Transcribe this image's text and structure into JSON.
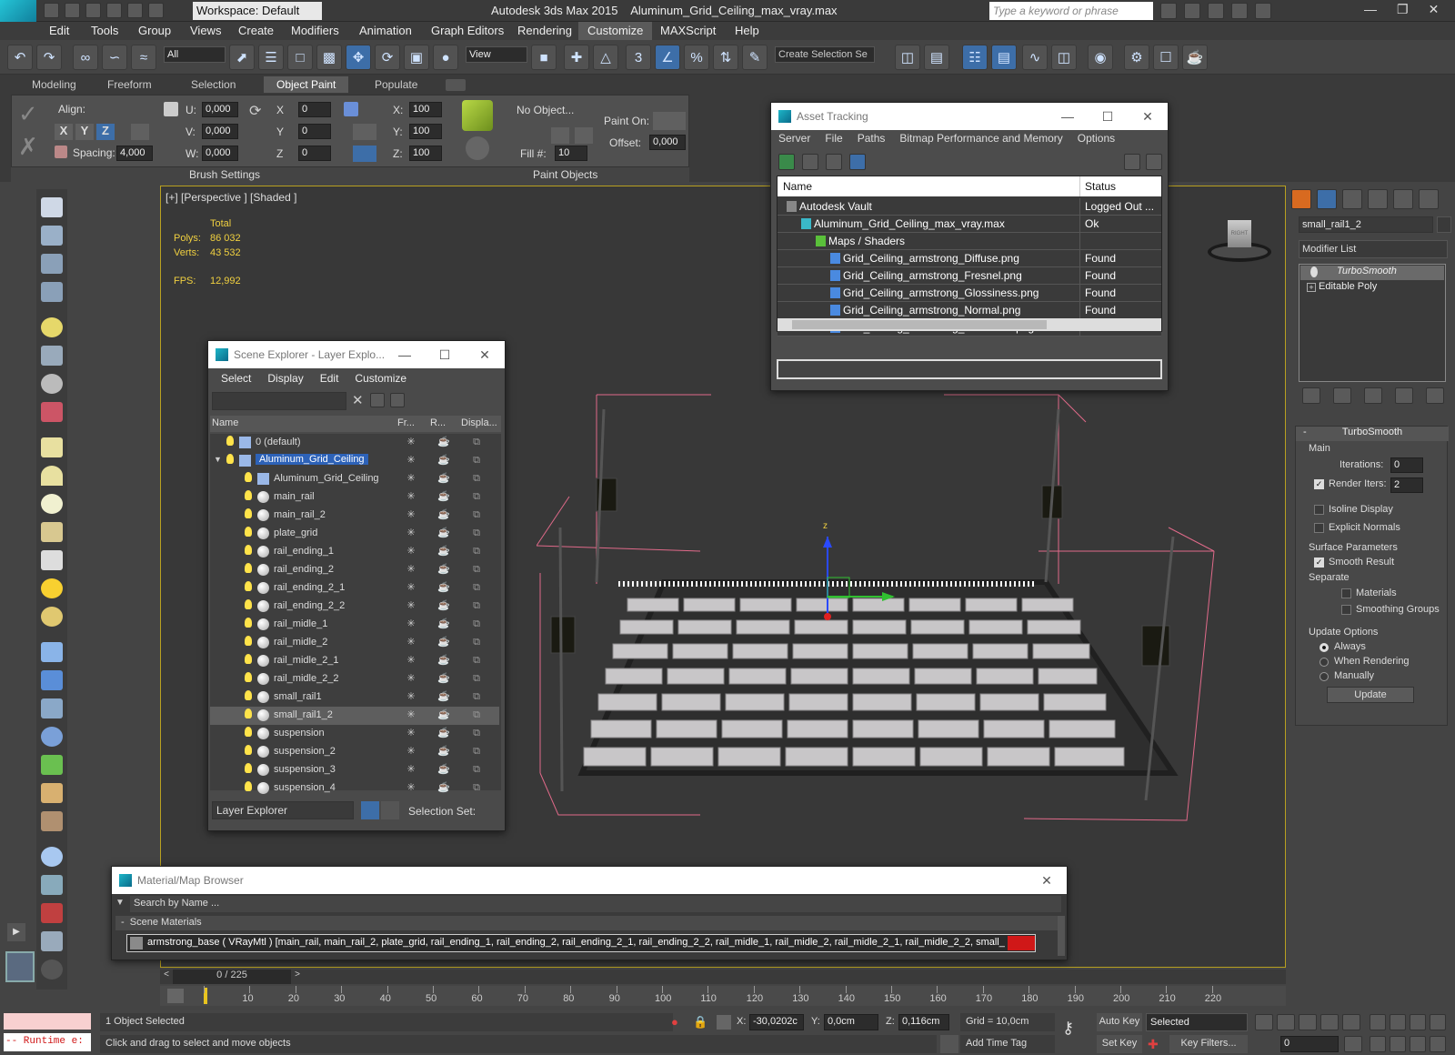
{
  "titlebar": {
    "app": "Autodesk 3ds Max  2015",
    "file": "Aluminum_Grid_Ceiling_max_vray.max",
    "workspace": "Workspace: Default",
    "search_placeholder": "Type a keyword or phrase",
    "logo_text": "MAX"
  },
  "menus": [
    "Edit",
    "Tools",
    "Group",
    "Views",
    "Create",
    "Modifiers",
    "Animation",
    "Graph Editors",
    "Rendering",
    "Customize",
    "MAXScript",
    "Help"
  ],
  "toolbar": {
    "filter": "All",
    "view": "View",
    "selection_set": "Create Selection Se",
    "snap_num": "3"
  },
  "ribbon": {
    "tabs": [
      "Modeling",
      "Freeform",
      "Selection",
      "Object Paint",
      "Populate"
    ],
    "active_tab": "Object Paint",
    "align_label": "Align:",
    "axes": [
      "X",
      "Y",
      "Z"
    ],
    "spacing_label": "Spacing:",
    "spacing_value": "4,000",
    "u_label": "U:",
    "v_label": "V:",
    "w_label": "W:",
    "uvw_value": "0,000",
    "x_label": "X",
    "y_label": "Y",
    "z_label": "Z",
    "xyz_value": "0",
    "sx_label": "X:",
    "sy_label": "Y:",
    "sz_label": "Z:",
    "scale_value": "100",
    "no_object": "No Object...",
    "fill_label": "Fill #:",
    "fill_value": "10",
    "paint_on_label": "Paint On:",
    "offset_label": "Offset:",
    "offset_value": "0,000",
    "brush_settings": "Brush Settings",
    "paint_objects": "Paint Objects"
  },
  "viewport": {
    "label": "[+] [Perspective ] [Shaded ]",
    "stats_header": "Total",
    "polys_label": "Polys:",
    "polys": "86 032",
    "verts_label": "Verts:",
    "verts": "43 532",
    "fps_label": "FPS:",
    "fps": "12,992",
    "gizmo_z": "z",
    "viewcube": "RIGHT"
  },
  "scene_explorer": {
    "title": "Scene Explorer - Layer Explo...",
    "menus": [
      "Select",
      "Display",
      "Edit",
      "Customize"
    ],
    "cols": [
      "Name",
      "Fr...",
      "R...",
      "Displa..."
    ],
    "layers": [
      {
        "name": "0 (default)",
        "level": 0,
        "kind": "layer"
      },
      {
        "name": "Aluminum_Grid_Ceiling",
        "level": 0,
        "kind": "layer",
        "selected": true
      },
      {
        "name": "Aluminum_Grid_Ceiling",
        "level": 1,
        "kind": "group"
      },
      {
        "name": "main_rail",
        "level": 1
      },
      {
        "name": "main_rail_2",
        "level": 1
      },
      {
        "name": "plate_grid",
        "level": 1
      },
      {
        "name": "rail_ending_1",
        "level": 1
      },
      {
        "name": "rail_ending_2",
        "level": 1
      },
      {
        "name": "rail_ending_2_1",
        "level": 1
      },
      {
        "name": "rail_ending_2_2",
        "level": 1
      },
      {
        "name": "rail_midle_1",
        "level": 1
      },
      {
        "name": "rail_midle_2",
        "level": 1
      },
      {
        "name": "rail_midle_2_1",
        "level": 1
      },
      {
        "name": "rail_midle_2_2",
        "level": 1
      },
      {
        "name": "small_rail1",
        "level": 1
      },
      {
        "name": "small_rail1_2",
        "level": 1,
        "highlight": true
      },
      {
        "name": "suspension",
        "level": 1
      },
      {
        "name": "suspension_2",
        "level": 1
      },
      {
        "name": "suspension_3",
        "level": 1
      },
      {
        "name": "suspension_4",
        "level": 1
      }
    ],
    "footer_dropdown": "Layer Explorer",
    "selection_set": "Selection Set:"
  },
  "asset_tracking": {
    "title": "Asset Tracking",
    "menus": [
      "Server",
      "File",
      "Paths",
      "Bitmap Performance and Memory",
      "Options"
    ],
    "col_name": "Name",
    "col_status": "Status",
    "rows": [
      {
        "name": "Autodesk Vault",
        "status": "Logged Out ...",
        "indent": 1
      },
      {
        "name": "Aluminum_Grid_Ceiling_max_vray.max",
        "status": "Ok",
        "indent": 2
      },
      {
        "name": "Maps / Shaders",
        "status": "",
        "indent": 3
      },
      {
        "name": "Grid_Ceiling_armstrong_Diffuse.png",
        "status": "Found",
        "indent": 4
      },
      {
        "name": "Grid_Ceiling_armstrong_Fresnel.png",
        "status": "Found",
        "indent": 4
      },
      {
        "name": "Grid_Ceiling_armstrong_Glossiness.png",
        "status": "Found",
        "indent": 4
      },
      {
        "name": "Grid_Ceiling_armstrong_Normal.png",
        "status": "Found",
        "indent": 4
      },
      {
        "name": "Grid_Ceiling_armstrong_Reflection.png",
        "status": "Found",
        "indent": 4
      }
    ]
  },
  "command_panel": {
    "object_name": "small_rail1_2",
    "modifier_list": "Modifier List",
    "stack": [
      "TurboSmooth",
      "Editable Poly"
    ],
    "rollout": "TurboSmooth",
    "main": "Main",
    "iterations_label": "Iterations:",
    "iterations": "0",
    "render_iters_label": "Render Iters:",
    "render_iters": "2",
    "isoline": "Isoline Display",
    "explicit": "Explicit Normals",
    "surface_params": "Surface Parameters",
    "smooth_result": "Smooth Result",
    "separate": "Separate",
    "materials": "Materials",
    "smoothing_groups": "Smoothing Groups",
    "update_options": "Update Options",
    "always": "Always",
    "when_rendering": "When Rendering",
    "manually": "Manually",
    "update": "Update"
  },
  "material_browser": {
    "title": "Material/Map Browser",
    "search": "Search by Name ...",
    "section": "Scene Materials",
    "entry": "armstrong_base  ( VRayMtl ) [main_rail, main_rail_2, plate_grid, rail_ending_1, rail_ending_2, rail_ending_2_1, rail_ending_2_2, rail_midle_1, rail_midle_2, rail_midle_2_1, rail_midle_2_2, small_"
  },
  "timeline": {
    "frame": "0 / 225",
    "ticks": [
      "0",
      "10",
      "20",
      "30",
      "40",
      "50",
      "60",
      "70",
      "80",
      "90",
      "100",
      "110",
      "120",
      "130",
      "140",
      "150",
      "160",
      "170",
      "180",
      "190",
      "200",
      "210",
      "220"
    ]
  },
  "status": {
    "runtime": "-- Runtime e:",
    "selected": "1 Object Selected",
    "prompt": "Click and drag to select and move objects",
    "x_label": "X:",
    "x": "-30,0202c",
    "y_label": "Y:",
    "y": "0,0cm",
    "z_label": "Z:",
    "z": "0,116cm",
    "grid": "Grid = 10,0cm",
    "add_time_tag": "Add Time Tag",
    "auto_key": "Auto Key",
    "set_key": "Set Key",
    "key_mode": "Selected",
    "key_filters": "Key Filters...",
    "frame_field": "0"
  }
}
